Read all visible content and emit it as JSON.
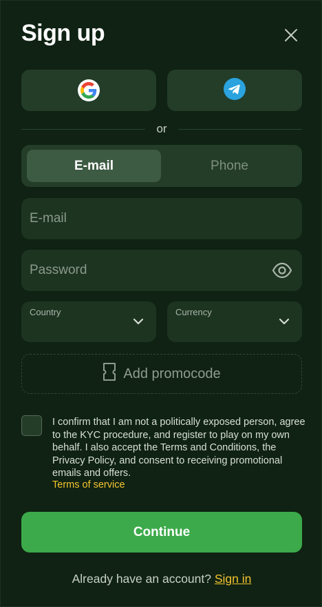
{
  "header": {
    "title": "Sign up",
    "close_icon": "close-icon"
  },
  "social": {
    "google_icon": "google-icon",
    "telegram_icon": "telegram-icon",
    "divider_text": "or"
  },
  "tabs": [
    {
      "label": "E-mail",
      "active": true
    },
    {
      "label": "Phone",
      "active": false
    }
  ],
  "form": {
    "email": {
      "placeholder": "E-mail",
      "value": ""
    },
    "password": {
      "placeholder": "Password",
      "value": "",
      "icon": "eye-icon"
    },
    "country": {
      "label": "Country",
      "value": ""
    },
    "currency": {
      "label": "Currency",
      "value": ""
    },
    "promocode": {
      "label": "Add promocode",
      "icon": "coupon-icon"
    }
  },
  "consent": {
    "checked": false,
    "text": "I confirm that I am not a politically exposed person, agree to the KYC procedure, and register to play on my own behalf. I also accept the Terms and Conditions, the Privacy Policy, and consent to receiving promotional emails and offers.",
    "terms_link": "Terms of service"
  },
  "actions": {
    "continue_label": "Continue"
  },
  "footer": {
    "prompt": "Already have an account?",
    "signin_link": "Sign in"
  },
  "colors": {
    "background": "#0f2213",
    "surface": "#233d28",
    "field": "#1d3421",
    "primary": "#3caa4a",
    "link": "#f4c430",
    "telegram": "#2aa3de"
  }
}
